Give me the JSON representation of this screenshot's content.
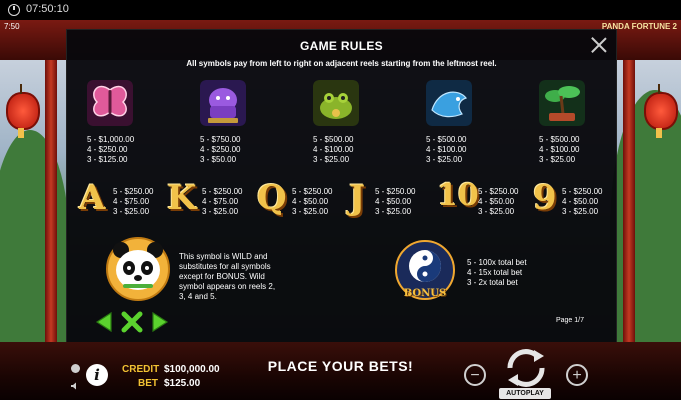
{
  "status": {
    "time": "07:50:10"
  },
  "game": {
    "small_time": "7:50",
    "title": "PANDA FORTUNE 2"
  },
  "dialog": {
    "title": "GAME RULES",
    "subtitle": "All symbols pay from left to right on adjacent reels starting from the leftmost reel.",
    "premium_symbols": [
      {
        "icon": "butterfly-icon",
        "pays": "5 - $1,000.00\n4 - $250.00\n3 - $125.00"
      },
      {
        "icon": "foo-dog-statue-icon",
        "pays": "5 - $750.00\n4 - $250.00\n3 - $50.00"
      },
      {
        "icon": "golden-toad-icon",
        "pays": "5 - $500.00\n4 - $100.00\n3 - $25.00"
      },
      {
        "icon": "dragon-fish-icon",
        "pays": "5 - $500.00\n4 - $100.00\n3 - $25.00"
      },
      {
        "icon": "bonsai-tree-icon",
        "pays": "5 - $500.00\n4 - $100.00\n3 - $25.00"
      }
    ],
    "card_symbols": [
      {
        "label": "A",
        "pays": "5 - $250.00\n4 - $75.00\n3 - $25.00"
      },
      {
        "label": "K",
        "pays": "5 - $250.00\n4 - $75.00\n3 - $25.00"
      },
      {
        "label": "Q",
        "pays": "5 - $250.00\n4 - $50.00\n3 - $25.00"
      },
      {
        "label": "J",
        "pays": "5 - $250.00\n4 - $50.00\n3 - $25.00"
      },
      {
        "label": "10",
        "pays": "5 - $250.00\n4 - $50.00\n3 - $25.00"
      },
      {
        "label": "9",
        "pays": "5 - $250.00\n4 - $50.00\n3 - $25.00"
      }
    ],
    "wild": {
      "icon": "panda-wild-icon",
      "description": "This symbol is WILD and substitutes for all symbols except for BONUS. Wild symbol appears on reels 2, 3, 4 and 5."
    },
    "bonus": {
      "icon": "yin-yang-bonus-icon",
      "label": "BONUS",
      "pays": "5 - 100x total bet\n4 - 15x total bet\n3 - 2x total bet"
    },
    "page_indicator": "Page 1/7"
  },
  "bottom": {
    "credit_label": "CREDIT",
    "credit_value": "$100,000.00",
    "bet_label": "BET",
    "bet_value": "$125.00",
    "message": "PLACE YOUR BETS!",
    "info_label": "i",
    "minus_label": "−",
    "plus_label": "+",
    "autoplay_label": "AUTOPLAY"
  },
  "colors": {
    "accent_gold": "#f2c233",
    "dialog_bg": "#08080c",
    "nav_green": "#5bd22e"
  }
}
